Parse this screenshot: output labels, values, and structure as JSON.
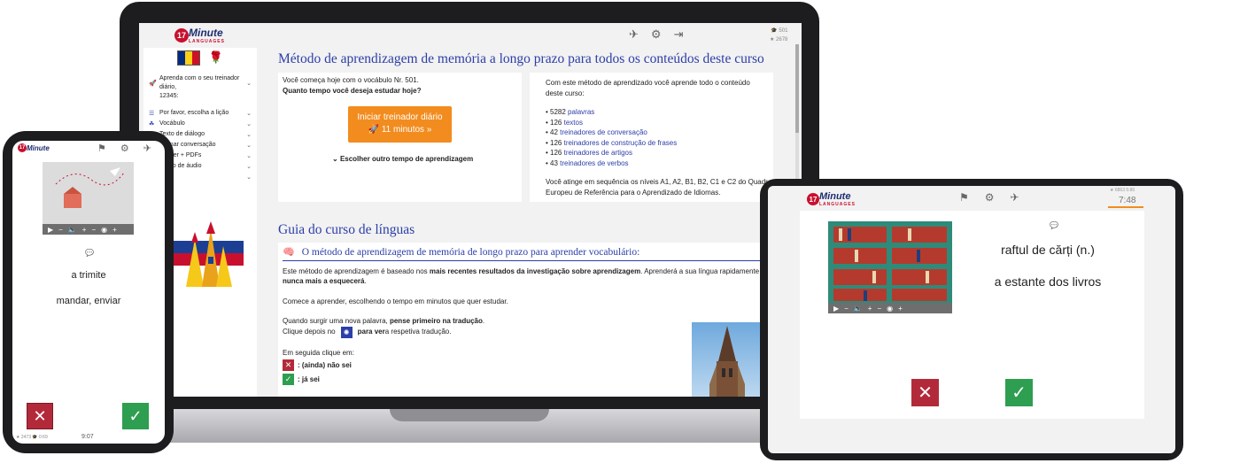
{
  "brand": {
    "logo_number": "17",
    "logo_word": "Minute",
    "logo_sub": "LANGUAGES"
  },
  "colors": {
    "brand_blue": "#2c3ea8",
    "orange": "#f28c1e",
    "red": "#b22a3a",
    "green": "#2e9e50"
  },
  "laptop": {
    "header": {
      "stats_top": "501",
      "stats_bottom": "2678",
      "icons": [
        "pin-icon",
        "gear-icon",
        "logout-icon"
      ]
    },
    "sidebar": {
      "trainer_lines": [
        "Aprenda com o seu treinador",
        "diário,",
        "12345:"
      ],
      "items": [
        {
          "label": "Por favor, escolha a lição"
        },
        {
          "label": "Vocábulo"
        },
        {
          "label": "Texto de diálogo"
        },
        {
          "label": "Treinar conversação"
        },
        {
          "label": "Trainer + PDFs"
        },
        {
          "label": "Curso de áudio"
        },
        {
          "label": ""
        }
      ]
    },
    "main": {
      "title": "Método de aprendizagem de memória a longo prazo para todos os conteúdos deste curso",
      "left_card": {
        "line1": "Você começa hoje com o vocábulo Nr. 501.",
        "line2": "Quanto tempo você deseja estudar hoje?",
        "button_line1": "Iniciar treinador diário",
        "button_line2": "11 minutos »",
        "other_time": "Escolher outro tempo de aprendizagem"
      },
      "right_card": {
        "intro": "Com este método de aprendizado você aprende todo o conteúdo deste curso:",
        "items": [
          {
            "count": "• 5282 ",
            "label": "palavras"
          },
          {
            "count": "• 126 ",
            "label": "textos"
          },
          {
            "count": "• 42 ",
            "label": "treinadores de conversação"
          },
          {
            "count": "• 126 ",
            "label": "treinadores de construção de frases"
          },
          {
            "count": "• 126 ",
            "label": "treinadores de artigos"
          },
          {
            "count": "• 43 ",
            "label": "treinadores de verbos"
          }
        ],
        "outro": "Você atinge em sequência os níveis A1, A2, B1, B2, C1 e C2 do Quadro Europeu de Referência para o Aprendizado de Idiomas."
      },
      "guide_title": "Guia do curso de línguas",
      "guide": {
        "heading": "O método de aprendizagem de memória de longo prazo para aprender vocabulário:",
        "p1_a": "Este método de aprendizagem é baseado nos ",
        "p1_b": "mais recentes resultados da investigação sobre aprendizagem",
        "p1_c": ". Aprenderá a sua língua rapidamente e ",
        "p1_d": "nunca mais a esquecerá",
        "p1_e": ".",
        "p2": "Comece a aprender, escolhendo o tempo em minutos que quer estudar.",
        "p3_a": "Quando surgir uma nova palavra, ",
        "p3_b": "pense primeiro na tradução",
        "p3_c": ".",
        "p4_a": "Clique depois no ",
        "p4_b": "para ver",
        "p4_c": " a respetiva tradução.",
        "p5": "Em seguida clique em:",
        "no_label": ": (ainda) não sei",
        "yes_label": ": já sei"
      }
    }
  },
  "phone": {
    "word": "a trimite",
    "translation": "mandar, enviar",
    "stats_left": "2473",
    "stats_mid": "0:69",
    "time": "9:07"
  },
  "tablet": {
    "word": "raftul de cărți (n.)",
    "translation": "a estante dos livros",
    "stats": "6863  5:86",
    "time": "7:48"
  }
}
